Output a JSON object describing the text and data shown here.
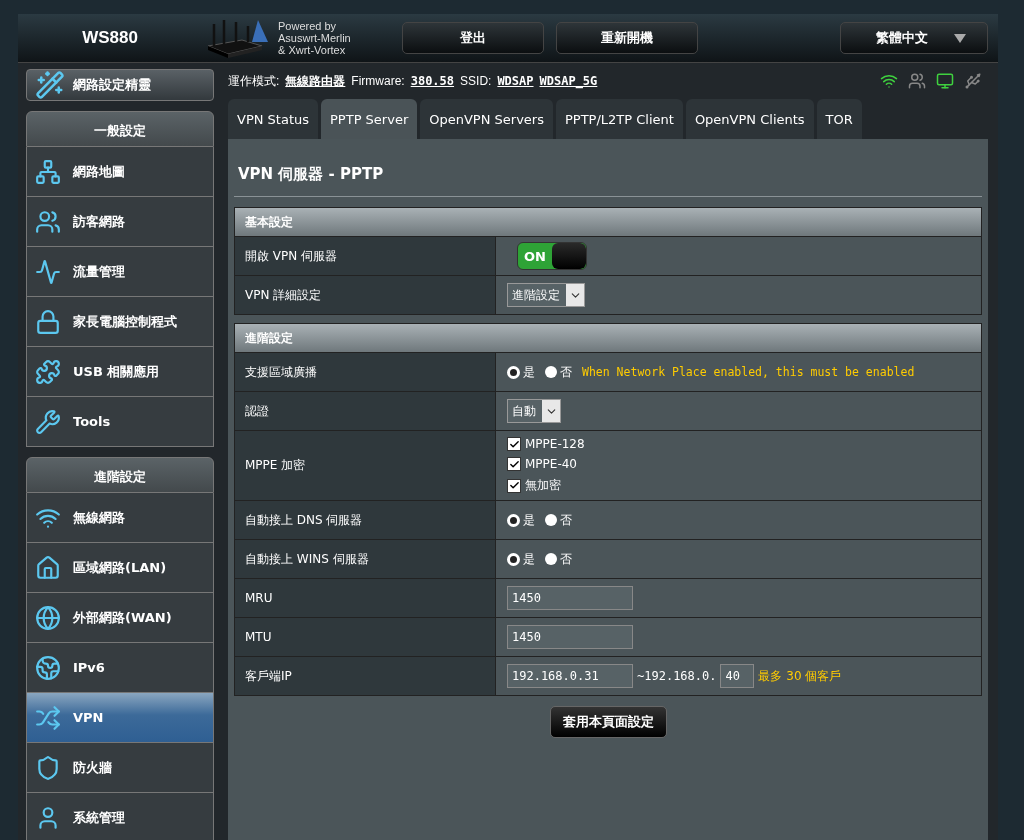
{
  "header": {
    "model": "WS880",
    "powered_by": [
      "Powered by",
      "Asuswrt-Merlin",
      "& Xwrt-Vortex"
    ],
    "buttons": [
      "登出",
      "重新開機"
    ],
    "language": "繁體中文"
  },
  "status_line": {
    "mode_label": "運作模式:",
    "mode": "無線路由器",
    "firmware_label": "Firmware:",
    "firmware": "380.58",
    "ssid_label": "SSID:",
    "ssids": [
      "WDSAP",
      "WDSAP_5G"
    ]
  },
  "wizard": "網路設定精靈",
  "sidebar": [
    {
      "title": "一般設定",
      "items": [
        {
          "label": "網路地圖",
          "selected": false
        },
        {
          "label": "訪客網路",
          "selected": false
        },
        {
          "label": "流量管理",
          "selected": false
        },
        {
          "label": "家長電腦控制程式",
          "selected": false
        },
        {
          "label": "USB 相關應用",
          "selected": false
        },
        {
          "label": "Tools",
          "selected": false
        }
      ]
    },
    {
      "title": "進階設定",
      "items": [
        {
          "label": "無線網路",
          "selected": false
        },
        {
          "label": "區域網路(LAN)",
          "selected": false
        },
        {
          "label": "外部網路(WAN)",
          "selected": false
        },
        {
          "label": "IPv6",
          "selected": false
        },
        {
          "label": "VPN",
          "selected": true
        },
        {
          "label": "防火牆",
          "selected": false
        },
        {
          "label": "系統管理",
          "selected": false
        }
      ]
    }
  ],
  "tabs": [
    {
      "label": "VPN Status",
      "selected": false
    },
    {
      "label": "PPTP Server",
      "selected": true
    },
    {
      "label": "OpenVPN Servers",
      "selected": false
    },
    {
      "label": "PPTP/L2TP Client",
      "selected": false
    },
    {
      "label": "OpenVPN Clients",
      "selected": false
    },
    {
      "label": "TOR",
      "selected": false
    }
  ],
  "panel_title": "VPN 伺服器 - PPTP",
  "sections": [
    {
      "title": "基本設定",
      "rows": [
        {
          "label": "開啟 VPN 伺服器",
          "kind": "switch",
          "on": true,
          "text": "ON"
        },
        {
          "label": "VPN 詳細設定",
          "kind": "select",
          "value": "進階設定"
        }
      ]
    },
    {
      "title": "進階設定",
      "rows": [
        {
          "label": "支援區域廣播",
          "kind": "radio",
          "options": [
            {
              "label": "是",
              "selected": true
            },
            {
              "label": "否",
              "selected": false
            }
          ],
          "note": "When Network Place enabled, this must be enabled"
        },
        {
          "label": "認證",
          "kind": "select",
          "value": "自動"
        },
        {
          "label": "MPPE 加密",
          "kind": "checkboxes",
          "options": [
            {
              "label": "MPPE-128",
              "checked": true
            },
            {
              "label": "MPPE-40",
              "checked": true
            },
            {
              "label": "無加密",
              "checked": true
            }
          ]
        },
        {
          "label": "自動接上 DNS 伺服器",
          "kind": "radio",
          "options": [
            {
              "label": "是",
              "selected": true
            },
            {
              "label": "否",
              "selected": false
            }
          ]
        },
        {
          "label": "自動接上 WINS 伺服器",
          "kind": "radio",
          "options": [
            {
              "label": "是",
              "selected": true
            },
            {
              "label": "否",
              "selected": false
            }
          ]
        },
        {
          "label": "MRU",
          "kind": "input",
          "value": "1450"
        },
        {
          "label": "MTU",
          "kind": "input",
          "value": "1450"
        },
        {
          "label": "客戶端IP",
          "kind": "ip_range",
          "start": "192.168.0.31",
          "separator": "~",
          "prefix": "192.168.0.",
          "end": "40",
          "note": "最多 30 個客戶"
        }
      ]
    }
  ],
  "apply_button": "套用本頁面設定"
}
